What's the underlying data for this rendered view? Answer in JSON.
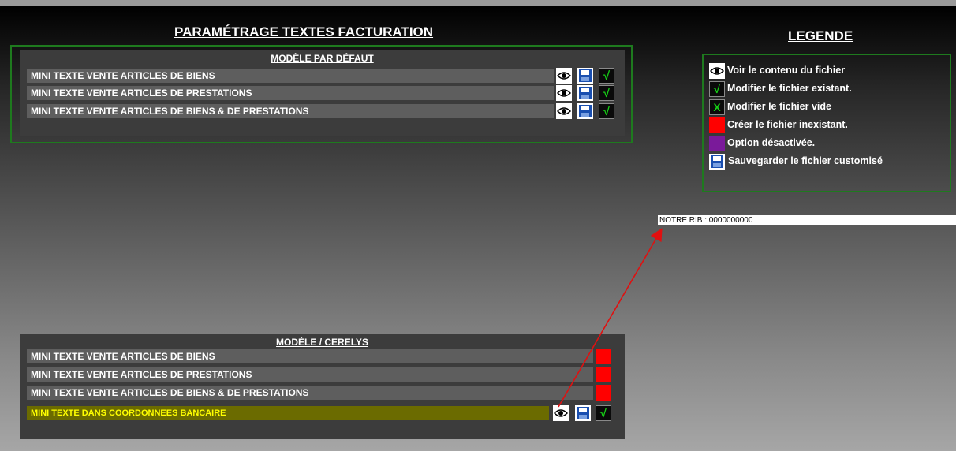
{
  "page_title": "PARAMÉTRAGE TEXTES FACTURATION",
  "legend": {
    "title": "LEGENDE",
    "items": [
      {
        "icon": "eye-icon",
        "label": "Voir le contenu du fichier"
      },
      {
        "icon": "checkmark-icon",
        "label": "Modifier le fichier existant."
      },
      {
        "icon": "x-mark-icon",
        "label": "Modifier le fichier vide"
      },
      {
        "icon": "red-square-icon",
        "label": "Créer le fichier inexistant."
      },
      {
        "icon": "purple-square-icon",
        "label": "Option désactivée."
      },
      {
        "icon": "floppy-disk-icon",
        "label": "Sauvegarder le fichier customisé"
      }
    ]
  },
  "default_model": {
    "title": "MODÈLE PAR DÉFAUT",
    "rows": [
      {
        "label": "MINI TEXTE VENTE ARTICLES DE BIENS",
        "actions": [
          "view",
          "save",
          "edit"
        ]
      },
      {
        "label": "MINI TEXTE VENTE ARTICLES DE PRESTATIONS",
        "actions": [
          "view",
          "save",
          "edit"
        ]
      },
      {
        "label": "MINI TEXTE VENTE ARTICLES DE BIENS & DE PRESTATIONS",
        "actions": [
          "view",
          "save",
          "edit"
        ]
      }
    ]
  },
  "cerelys_model": {
    "title": "MODÈLE / CERELYS",
    "rows": [
      {
        "label": "MINI TEXTE VENTE ARTICLES DE BIENS",
        "actions": [
          "create"
        ]
      },
      {
        "label": "MINI TEXTE VENTE ARTICLES DE PRESTATIONS",
        "actions": [
          "create"
        ]
      },
      {
        "label": "MINI TEXTE VENTE ARTICLES DE BIENS & DE PRESTATIONS",
        "actions": [
          "create"
        ]
      },
      {
        "label": "MINI TEXTE DANS COORDONNEES BANCAIRE",
        "actions": [
          "view",
          "save",
          "edit"
        ],
        "highlighted": true
      }
    ]
  },
  "rib_preview": "NOTRE RIB : 0000000000",
  "colors": {
    "frame_green": "#1e7a1e",
    "check_green": "#16d016",
    "create_red": "#ff0000",
    "disabled_purple": "#7a1a9a",
    "highlight_row": "#6b6b00",
    "highlight_text": "#ffff00",
    "arrow_red": "#e01010"
  }
}
